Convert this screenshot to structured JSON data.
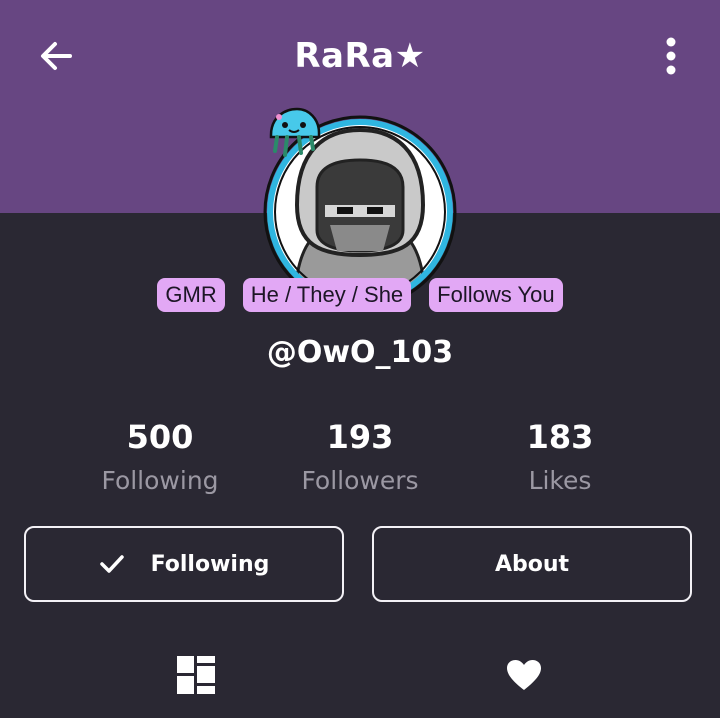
{
  "header": {
    "title": "RaRa★",
    "back_icon": "arrow-left-icon",
    "menu_icon": "more-vertical-icon",
    "background_color": "#674682"
  },
  "profile": {
    "badges": [
      "GMR",
      "He / They / She",
      "Follows You"
    ],
    "badge_color": "#e2a8f5",
    "handle": "@OwO_103",
    "avatar_ring_color": "#2fb6e0"
  },
  "stats": [
    {
      "value": "500",
      "label": "Following"
    },
    {
      "value": "193",
      "label": "Followers"
    },
    {
      "value": "183",
      "label": "Likes"
    }
  ],
  "actions": {
    "following_label": "Following",
    "following_icon": "check-icon",
    "about_label": "About"
  },
  "tabs": {
    "grid_icon": "grid-icon",
    "likes_icon": "heart-icon"
  }
}
